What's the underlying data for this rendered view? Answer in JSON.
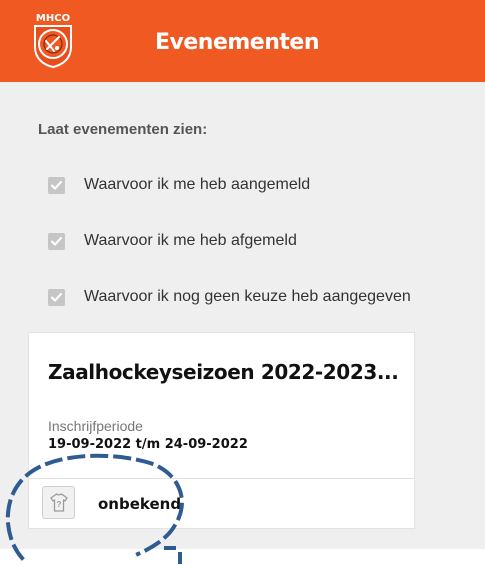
{
  "header": {
    "logo_text": "MHCO",
    "title": "Evenementen"
  },
  "filters": {
    "label": "Laat evenementen zien:",
    "items": [
      {
        "label": "Waarvoor ik me heb aangemeld",
        "checked": true
      },
      {
        "label": "Waarvoor ik me heb afgemeld",
        "checked": true
      },
      {
        "label": "Waarvoor ik nog geen keuze heb aangegeven",
        "checked": true
      }
    ]
  },
  "event": {
    "title": "Zaalhockeyseizoen 2022-2023...",
    "period_label": "Inschrijfperiode",
    "period_value": "19-09-2022 t/m 24-09-2022",
    "status_icon": "shirt-question-icon",
    "status": "onbekend"
  },
  "colors": {
    "header_bg": "#f05a22",
    "page_bg": "#efefef",
    "checkbox": "#c6c6c6",
    "annotation": "#2f5b93"
  }
}
